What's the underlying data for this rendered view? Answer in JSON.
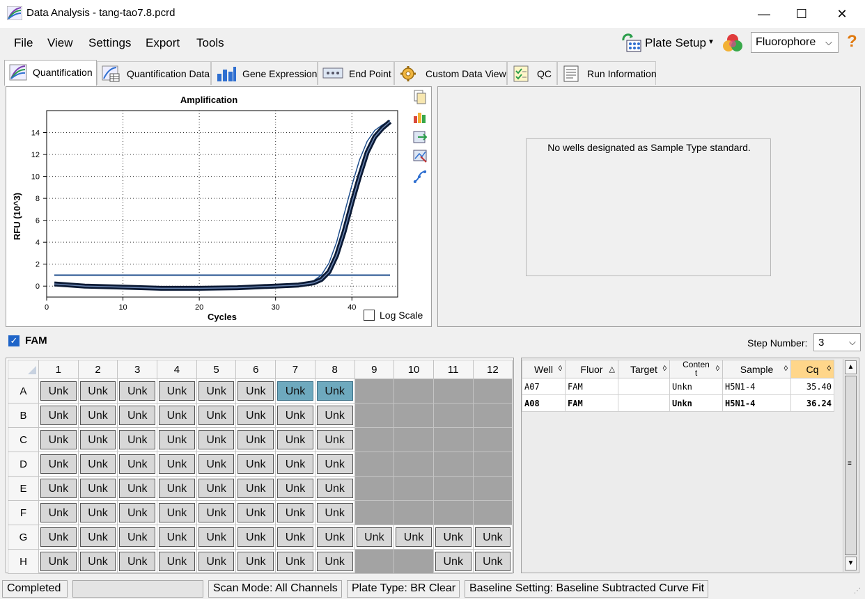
{
  "window": {
    "title": "Data Analysis - tang-tao7.8.pcrd"
  },
  "menu": {
    "file": "File",
    "view": "View",
    "settings": "Settings",
    "export": "Export",
    "tools": "Tools"
  },
  "toolbar": {
    "plate_setup": "Plate Setup",
    "fluorophore": "Fluorophore"
  },
  "tabs": [
    "Quantification",
    "Quantification Data",
    "Gene Expression",
    "End Point",
    "Custom Data View",
    "QC",
    "Run Information"
  ],
  "chart_data": {
    "type": "line",
    "title": "Amplification",
    "xlabel": "Cycles",
    "ylabel": "RFU (10^3)",
    "xlim": [
      0,
      46
    ],
    "ylim": [
      -1,
      16
    ],
    "xticks": [
      0,
      10,
      20,
      30,
      40
    ],
    "yticks": [
      0,
      2,
      4,
      6,
      8,
      10,
      12,
      14
    ],
    "grid": true,
    "threshold": 1.0,
    "series": [
      {
        "x": [
          1,
          5,
          10,
          15,
          20,
          25,
          30,
          33,
          35,
          36,
          37,
          38,
          39,
          40,
          41,
          42,
          43,
          44,
          45
        ],
        "y": [
          0.2,
          0.0,
          -0.1,
          -0.2,
          -0.2,
          -0.15,
          0.0,
          0.1,
          0.3,
          0.6,
          1.3,
          2.8,
          5.0,
          7.6,
          10.0,
          12.2,
          13.6,
          14.4,
          15.0
        ]
      },
      {
        "x": [
          1,
          5,
          10,
          15,
          20,
          25,
          30,
          33,
          35,
          36,
          37,
          38,
          39,
          40,
          41,
          42,
          43,
          44,
          45
        ],
        "y": [
          0.25,
          0.05,
          -0.05,
          -0.15,
          -0.15,
          -0.1,
          0.05,
          0.15,
          0.5,
          1.0,
          2.1,
          4.0,
          6.6,
          9.2,
          11.5,
          13.2,
          14.2,
          14.7,
          15.1
        ]
      }
    ]
  },
  "chart": {
    "log_scale_label": "Log Scale"
  },
  "standard_message": "No wells designated as Sample Type standard.",
  "fam": {
    "label": "FAM",
    "step_label": "Step Number:",
    "step_value": "3"
  },
  "plate": {
    "columns": [
      "1",
      "2",
      "3",
      "4",
      "5",
      "6",
      "7",
      "8",
      "9",
      "10",
      "11",
      "12"
    ],
    "rows": [
      "A",
      "B",
      "C",
      "D",
      "E",
      "F",
      "G",
      "H"
    ],
    "cell_label": "Unk",
    "cells": [
      [
        "Unk",
        "Unk",
        "Unk",
        "Unk",
        "Unk",
        "Unk",
        "Unk*",
        "Unk*",
        "",
        "",
        "",
        ""
      ],
      [
        "Unk",
        "Unk",
        "Unk",
        "Unk",
        "Unk",
        "Unk",
        "Unk",
        "Unk",
        "",
        "",
        "",
        ""
      ],
      [
        "Unk",
        "Unk",
        "Unk",
        "Unk",
        "Unk",
        "Unk",
        "Unk",
        "Unk",
        "",
        "",
        "",
        ""
      ],
      [
        "Unk",
        "Unk",
        "Unk",
        "Unk",
        "Unk",
        "Unk",
        "Unk",
        "Unk",
        "",
        "",
        "",
        ""
      ],
      [
        "Unk",
        "Unk",
        "Unk",
        "Unk",
        "Unk",
        "Unk",
        "Unk",
        "Unk",
        "",
        "",
        "",
        ""
      ],
      [
        "Unk",
        "Unk",
        "Unk",
        "Unk",
        "Unk",
        "Unk",
        "Unk",
        "Unk",
        "",
        "",
        "",
        ""
      ],
      [
        "Unk",
        "Unk",
        "Unk",
        "Unk",
        "Unk",
        "Unk",
        "Unk",
        "Unk",
        "Unk",
        "Unk",
        "Unk",
        "Unk"
      ],
      [
        "Unk",
        "Unk",
        "Unk",
        "Unk",
        "Unk",
        "Unk",
        "Unk",
        "Unk",
        "",
        "",
        "Unk",
        "Unk"
      ]
    ]
  },
  "results": {
    "headers": [
      "Well",
      "Fluor",
      "Target",
      "Conten\nt",
      "Sample",
      "Cq"
    ],
    "rows": [
      {
        "well": "A07",
        "fluor": "FAM",
        "target": "",
        "content": "Unkn",
        "sample": "H5N1-4",
        "cq": "35.40"
      },
      {
        "well": "A08",
        "fluor": "FAM",
        "target": "",
        "content": "Unkn",
        "sample": "H5N1-4",
        "cq": "36.24"
      }
    ]
  },
  "status": {
    "state": "Completed",
    "scan_mode": "Scan Mode: All Channels",
    "plate_type": "Plate Type: BR Clear",
    "baseline": "Baseline Setting: Baseline Subtracted Curve Fit"
  },
  "colors": {
    "accent": "#1e64c8",
    "selected_well": "#6ea9be",
    "empty_well": "#a3a3a3",
    "sorted_header": "#ffd68a",
    "curve": "#0b1a35",
    "threshold": "#1f4e8c"
  }
}
